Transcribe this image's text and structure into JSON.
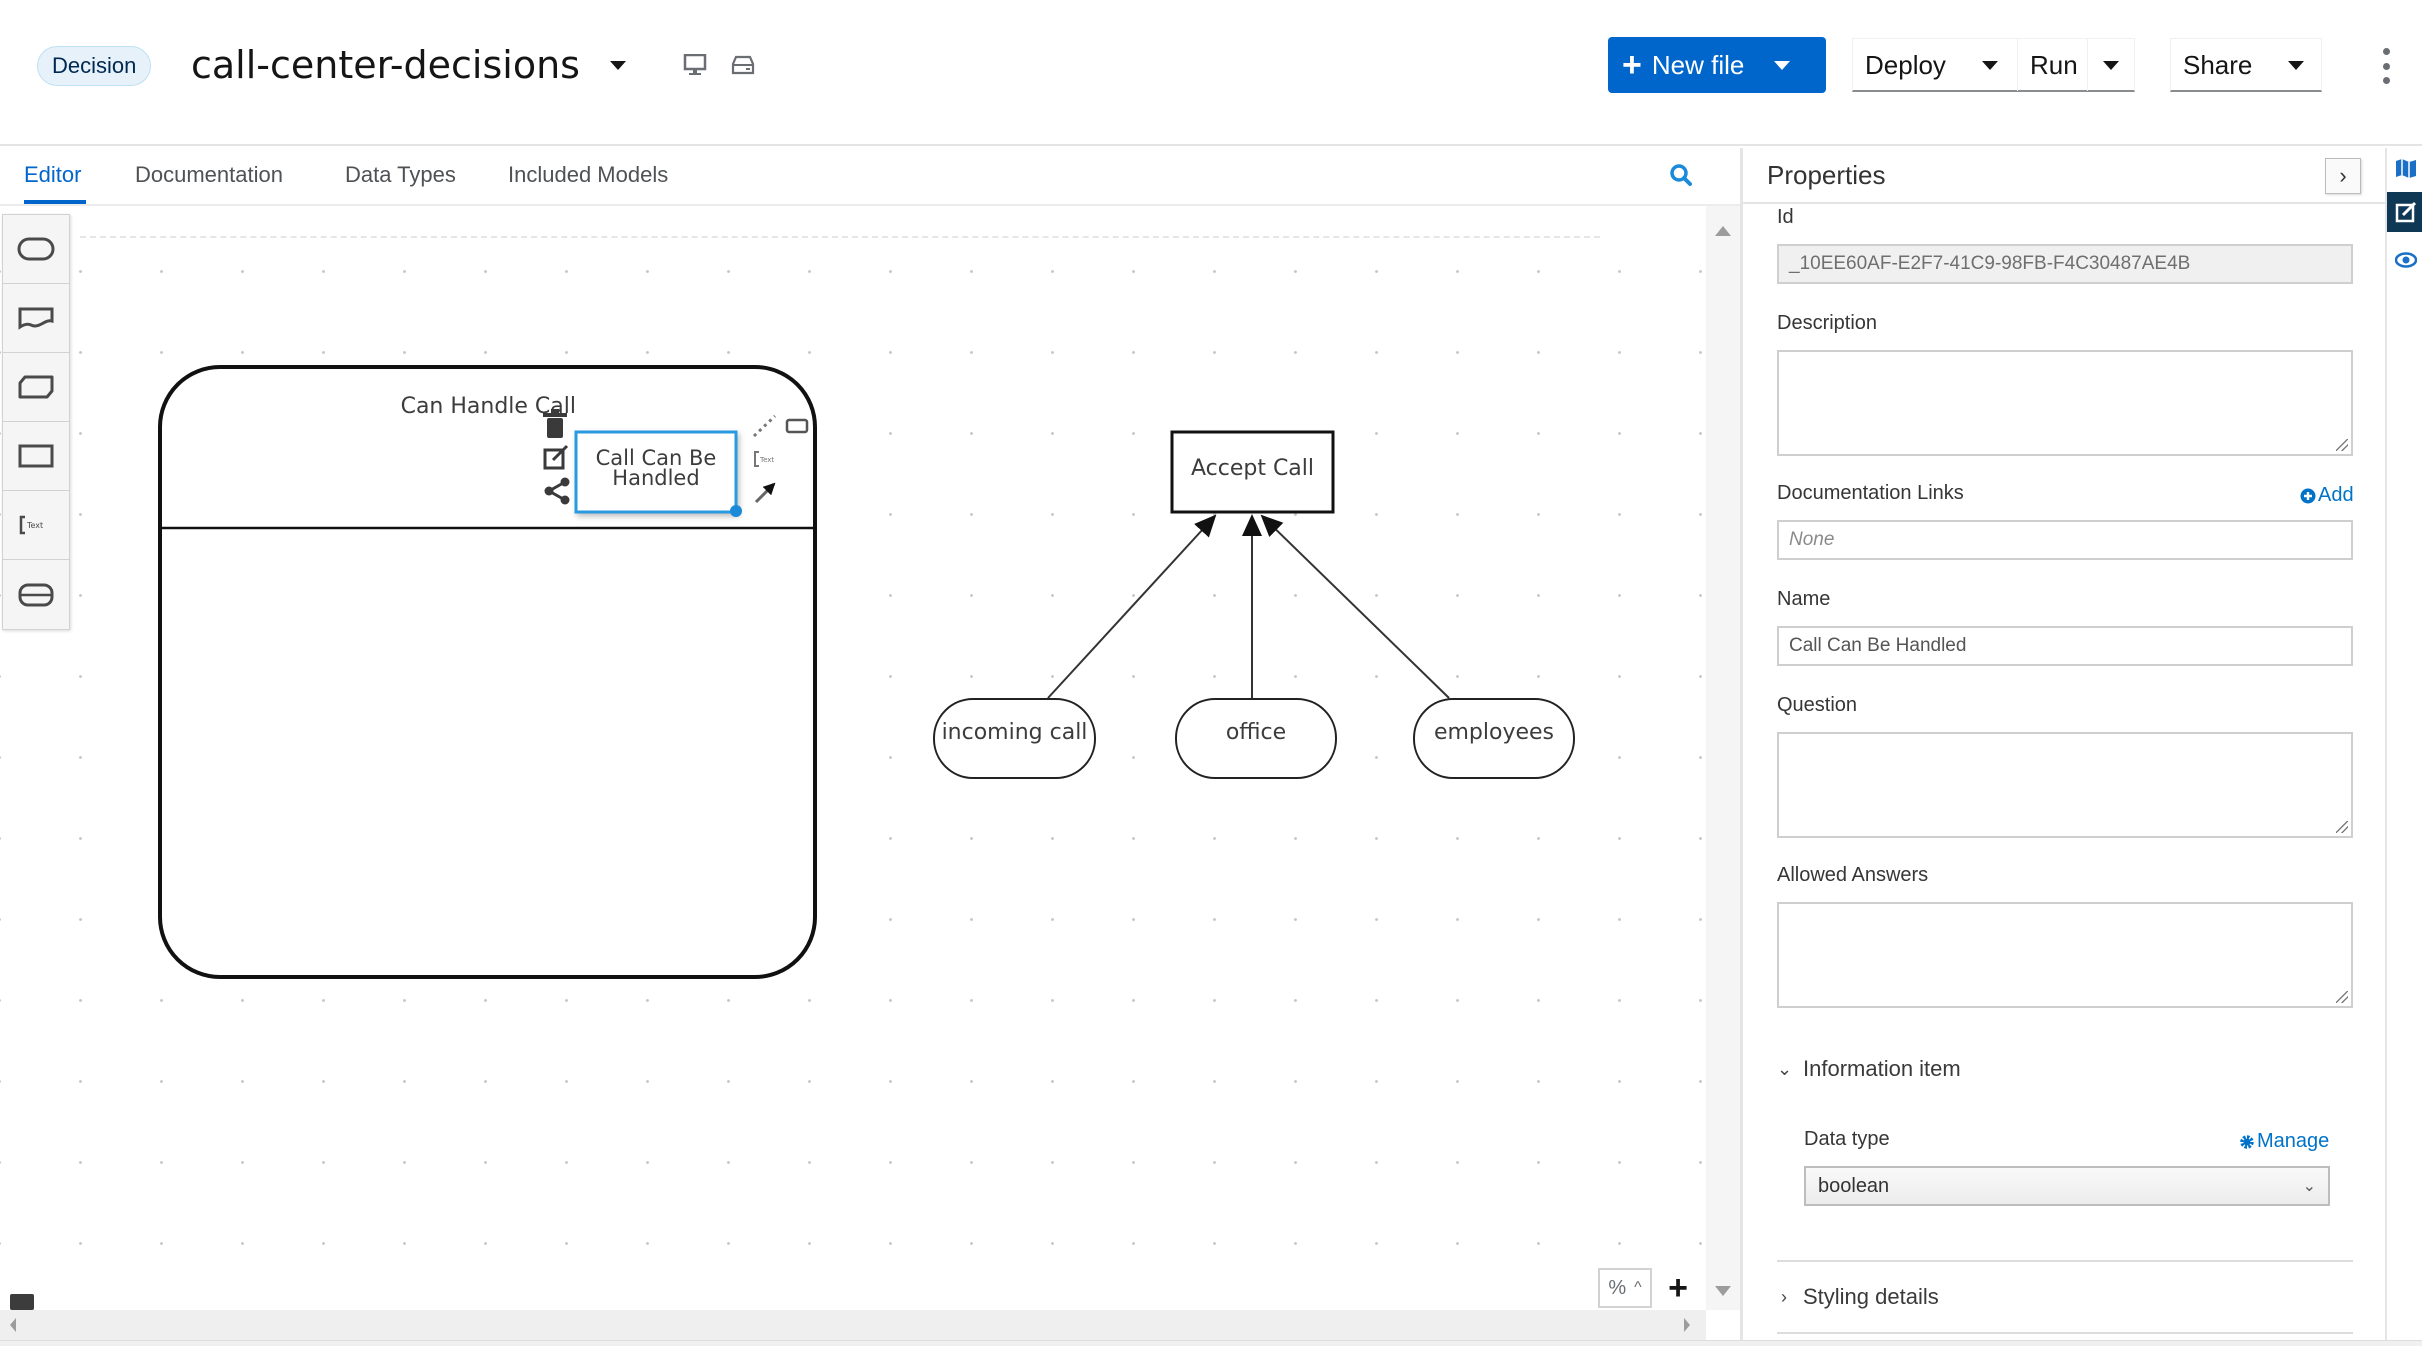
{
  "header": {
    "badge": "Decision",
    "file_name": "call-center-decisions",
    "new_file_label": "New file",
    "deploy_label": "Deploy",
    "run_label": "Run",
    "share_label": "Share",
    "brand_color": "#0066cc"
  },
  "tabs": [
    {
      "label": "Editor",
      "active": true
    },
    {
      "label": "Documentation",
      "active": false
    },
    {
      "label": "Data Types",
      "active": false
    },
    {
      "label": "Included Models",
      "active": false
    }
  ],
  "palette": [
    {
      "icon": "input-data-icon"
    },
    {
      "icon": "knowledge-source-icon"
    },
    {
      "icon": "business-knowledge-model-icon"
    },
    {
      "icon": "decision-icon"
    },
    {
      "icon": "text-annotation-icon"
    },
    {
      "icon": "decision-service-icon"
    }
  ],
  "diagram": {
    "decision_service": {
      "label": "Can Handle Call"
    },
    "selected_decision": {
      "label_line1": "Call Can Be",
      "label_line2": "Handled"
    },
    "accept_call": {
      "label": "Accept Call"
    },
    "inputs": [
      {
        "label": "incoming call"
      },
      {
        "label": "office"
      },
      {
        "label": "employees"
      }
    ]
  },
  "canvas_controls": {
    "zoom_text": "%"
  },
  "properties": {
    "title": "Properties",
    "id_label": "Id",
    "id_value": "_10EE60AF-E2F7-41C9-98FB-F4C30487AE4B",
    "description_label": "Description",
    "description_value": "",
    "doc_links_label": "Documentation Links",
    "doc_links_add": "Add",
    "doc_links_placeholder": "None",
    "name_label": "Name",
    "name_value": "Call Can Be Handled",
    "question_label": "Question",
    "question_value": "",
    "allowed_answers_label": "Allowed Answers",
    "allowed_answers_value": "",
    "info_item_section": "Information item",
    "data_type_label": "Data type",
    "data_type_manage": "Manage",
    "data_type_value": "boolean",
    "styling_section": "Styling details"
  }
}
